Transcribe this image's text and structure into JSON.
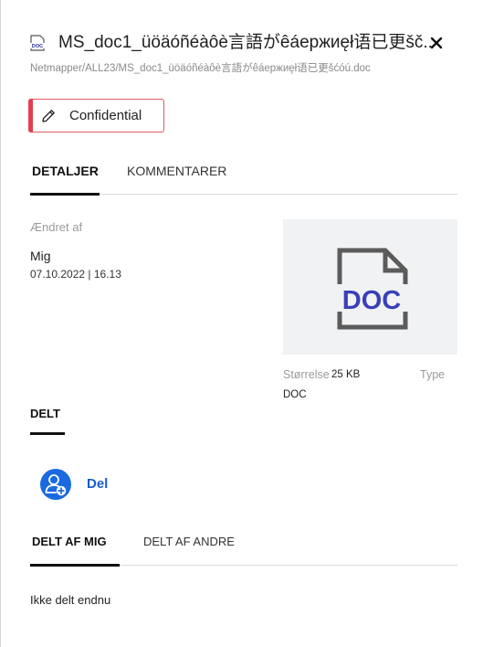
{
  "header": {
    "file_icon": "doc-file-icon",
    "file_icon_text": "DOC",
    "title": "MS_doc1_üöäóñéàôè言語がêáеpжиęł语已更šč...",
    "path": "Netmapper/ALL23/MS_doc1_üöäóñéàôè言語がêáеpжиęł语已更šćóú.doc",
    "close_icon": "close-icon"
  },
  "tag": {
    "label": "Confidential",
    "icon": "pencil-icon",
    "color": "#e0404f"
  },
  "tabs": [
    {
      "label": "DETALJER",
      "active": true
    },
    {
      "label": "KOMMENTARER",
      "active": false
    }
  ],
  "details": {
    "modified_label": "Ændret af",
    "modified_by": "Mig",
    "modified_date": "07.10.2022 | 16.13",
    "preview_text": "DOC",
    "size_label": "Størrelse",
    "size_value": "25 KB",
    "type_label": "Type",
    "type_value": "DOC"
  },
  "shared": {
    "heading": "DELT",
    "share_button_label": "Del",
    "share_icon": "add-user-icon",
    "tabs": [
      {
        "label": "DELT AF MIG",
        "active": true
      },
      {
        "label": "DELT AF ANDRE",
        "active": false
      }
    ],
    "empty_message": "Ikke delt endnu"
  },
  "colors": {
    "accent": "#1a6ae0",
    "preview_doc": "#3a3fb8",
    "tag_border": "#e05a64"
  }
}
